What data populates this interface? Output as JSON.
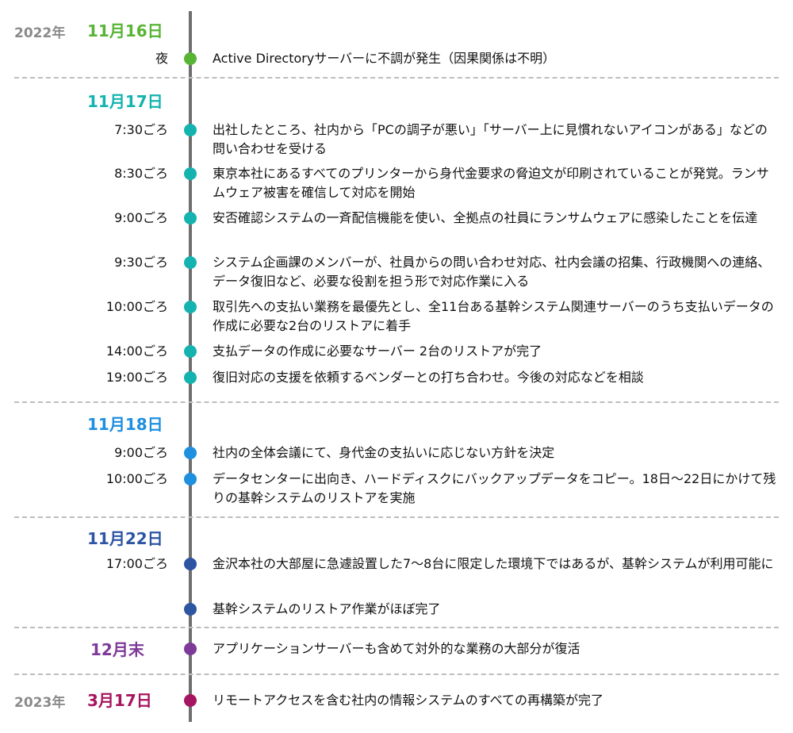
{
  "colors": {
    "nov16": "#58b435",
    "nov17": "#14b3b0",
    "nov18": "#1f8fe0",
    "nov22": "#2d55a2",
    "dec": "#7d3a98",
    "mar": "#a6155f"
  },
  "sections": [
    {
      "year": "2022年",
      "date": "11月16日",
      "events": [
        {
          "time": "夜",
          "text": "Active Directoryサーバーに不調が発生（因果関係は不明）"
        }
      ]
    },
    {
      "date": "11月17日",
      "events": [
        {
          "time": "7:30ごろ",
          "text": "出社したところ、社内から「PCの調子が悪い」「サーバー上に見慣れないアイコンがある」などの問い合わせを受ける"
        },
        {
          "time": "8:30ごろ",
          "text": "東京本社にあるすべてのプリンターから身代金要求の脅迫文が印刷されていることが発覚。ランサムウェア被害を確信して対応を開始"
        },
        {
          "time": "9:00ごろ",
          "text": "安否確認システムの一斉配信機能を使い、全拠点の社員にランサムウェアに感染したことを伝達"
        },
        {
          "time": "9:30ごろ",
          "text": "システム企画課のメンバーが、社員からの問い合わせ対応、社内会議の招集、行政機関への連絡、データ復旧など、必要な役割を担う形で対応作業に入る"
        },
        {
          "time": "10:00ごろ",
          "text": "取引先への支払い業務を最優先とし、全11台ある基幹システム関連サーバーのうち支払いデータの作成に必要な2台のリストアに着手"
        },
        {
          "time": "14:00ごろ",
          "text": "支払データの作成に必要なサーバー 2台のリストアが完了"
        },
        {
          "time": "19:00ごろ",
          "text": "復旧対応の支援を依頼するベンダーとの打ち合わせ。今後の対応などを相談"
        }
      ]
    },
    {
      "date": "11月18日",
      "events": [
        {
          "time": "9:00ごろ",
          "text": "社内の全体会議にて、身代金の支払いに応じない方針を決定"
        },
        {
          "time": "10:00ごろ",
          "text": "データセンターに出向き、ハードディスクにバックアップデータをコピー。18日～22日にかけて残りの基幹システムのリストアを実施"
        }
      ]
    },
    {
      "date": "11月22日",
      "events": [
        {
          "time": "17:00ごろ",
          "text": "金沢本社の大部屋に急遽設置した7～8台に限定した環境下ではあるが、基幹システムが利用可能に"
        },
        {
          "time": "",
          "text": "基幹システムのリストア作業がほぼ完了"
        }
      ]
    },
    {
      "date": "12月末",
      "events": [
        {
          "time": "",
          "text": "アプリケーションサーバーも含めて対外的な業務の大部分が復活"
        }
      ]
    },
    {
      "year": "2023年",
      "date": "3月17日",
      "events": [
        {
          "time": "",
          "text": "リモートアクセスを含む社内の情報システムのすべての再構築が完了"
        }
      ]
    }
  ]
}
